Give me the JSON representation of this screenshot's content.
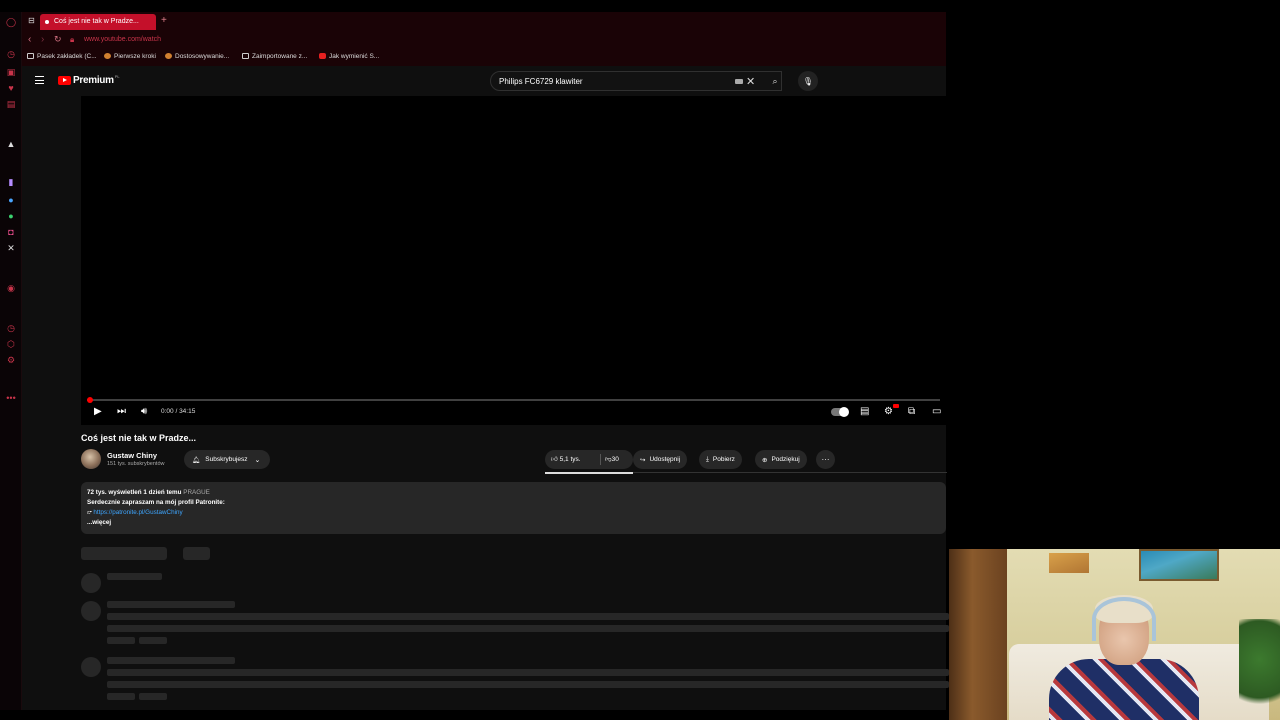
{
  "browser": {
    "tab_title": "Coś jest nie tak w Pradze...",
    "new_tab": "+",
    "url": "www.youtube.com/watch",
    "bookmarks": [
      "Pasek zakładek (C...",
      "Pierwsze kroki",
      "Dostosowywanie...",
      "Zaimportowane z...",
      "Jak wymienić S..."
    ]
  },
  "header": {
    "brand": "Premium",
    "country": "PL",
    "search_value": "Philips FC6729 klawiter"
  },
  "player": {
    "time": "0:00 / 34:15",
    "progress": 0.0
  },
  "video": {
    "title": "Coś jest nie tak w Pradze...",
    "channel_name": "Gustaw Chiny",
    "channel_subs": "151 tys. subskrybentów",
    "subscribe_label": "Subskrybujesz",
    "likes": "5,1 tys.",
    "dislikes": "30",
    "share_label": "Udostępnij",
    "download_label": "Pobierz",
    "thanks_label": "Podziękuj"
  },
  "description": {
    "views_date": "72 tys. wyświetleń  1 dzień temu",
    "tag": "PRAGUE",
    "line1": "Serdecznie zapraszam na mój profil Patronite:",
    "link": "https://patronite.pl/GustawChiny",
    "more": "...więcej"
  },
  "colors": {
    "accent": "#ff0000",
    "browser_chrome": "#1a0306",
    "tab_active": "#c4102a",
    "link": "#3ea6ff"
  }
}
